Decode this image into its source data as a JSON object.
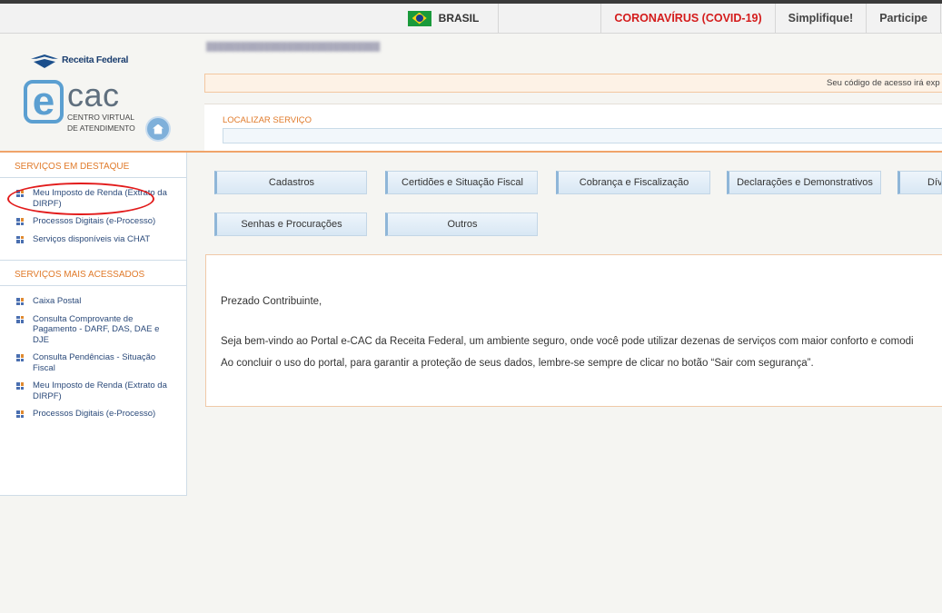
{
  "gov_bar": {
    "country": "BRASIL",
    "links": [
      "CORONAVÍRUS (COVID-19)",
      "Simplifique!",
      "Participe"
    ]
  },
  "header": {
    "brand": "Receita Federal",
    "logo_text": "cac",
    "logo_letter": "e",
    "logo_subtitle_1": "CENTRO VIRTUAL",
    "logo_subtitle_2": "DE ATENDIMENTO"
  },
  "notice": {
    "text": "Seu código de acesso irá exp"
  },
  "search": {
    "label": "LOCALIZAR SERVIÇO",
    "value": ""
  },
  "sidebar": {
    "featured_title": "SERVIÇOS EM DESTAQUE",
    "featured": [
      "Meu Imposto de Renda (Extrato da DIRPF)",
      "Processos Digitais (e-Processo)",
      "Serviços disponíveis via CHAT"
    ],
    "most_accessed_title": "SERVIÇOS MAIS ACESSADOS",
    "most_accessed": [
      "Caixa Postal",
      "Consulta Comprovante de Pagamento - DARF, DAS, DAE e DJE",
      "Consulta Pendências - Situação Fiscal",
      "Meu Imposto de Renda (Extrato da DIRPF)",
      "Processos Digitais (e-Processo)"
    ]
  },
  "categories": [
    "Cadastros",
    "Certidões e Situação Fiscal",
    "Cobrança e Fiscalização",
    "Declarações e Demonstrativos",
    "Dív",
    "Senhas e Procurações",
    "Outros"
  ],
  "welcome": {
    "greeting": "Prezado Contribuinte,",
    "line1": "Seja bem-vindo ao Portal e-CAC da Receita Federal, um ambiente seguro, onde você pode utilizar dezenas de serviços com maior conforto e comodi",
    "line2": "Ao concluir o uso do portal, para garantir a proteção de seus dados, lembre-se sempre de clicar no botão “Sair com segurança”."
  },
  "colors": {
    "accent_orange": "#e07a2a",
    "link_blue": "#2b4a7a",
    "covid_red": "#d41c1c",
    "annotation_red": "#e21b1b"
  },
  "icons": [
    "brazil-flag-icon",
    "receita-federal-logo-icon",
    "home-icon",
    "bullet-squares-icon"
  ]
}
